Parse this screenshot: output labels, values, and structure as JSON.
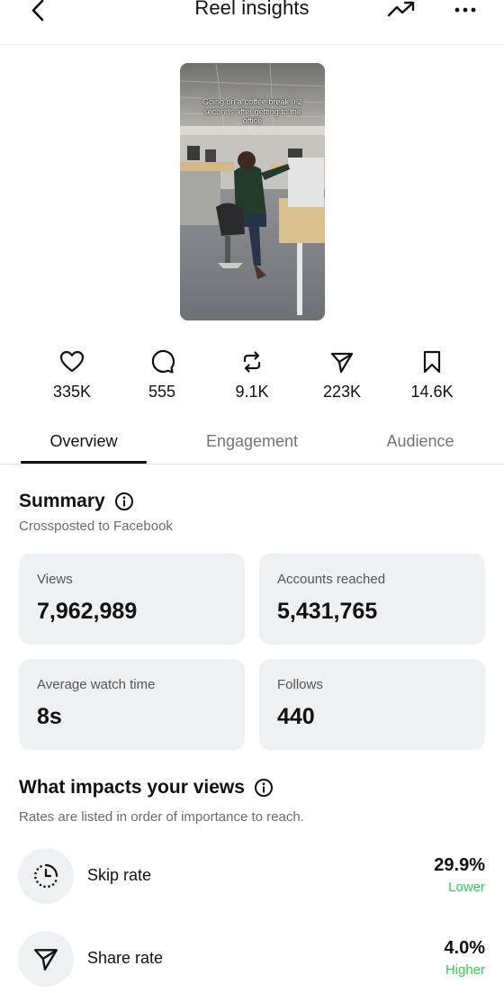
{
  "header": {
    "title": "Reel insights",
    "back_icon": "chevron-left-icon",
    "trend_icon": "trending-up-icon",
    "more_icon": "more-horizontal-icon"
  },
  "thumbnail": {
    "caption": "Going on a coffee break 0.2 seconds after getting to the office"
  },
  "stats": [
    {
      "icon": "heart-icon",
      "value": "335K"
    },
    {
      "icon": "comment-icon",
      "value": "555"
    },
    {
      "icon": "repost-icon",
      "value": "9.1K"
    },
    {
      "icon": "share-icon",
      "value": "223K"
    },
    {
      "icon": "bookmark-icon",
      "value": "14.6K"
    }
  ],
  "tabs": {
    "overview": "Overview",
    "engagement": "Engagement",
    "audience": "Audience",
    "active": "Overview"
  },
  "summary": {
    "title": "Summary",
    "subtitle": "Crossposted to Facebook",
    "cards": {
      "views": {
        "label": "Views",
        "value": "7,962,989"
      },
      "accounts_reached": {
        "label": "Accounts reached",
        "value": "5,431,765"
      },
      "avg_watch_time": {
        "label": "Average watch time",
        "value": "8s"
      },
      "follows": {
        "label": "Follows",
        "value": "440"
      }
    }
  },
  "impacts": {
    "title": "What impacts your views",
    "subtitle": "Rates are listed in order of importance to reach.",
    "metrics": {
      "skip": {
        "icon": "clock-dotted-icon",
        "name": "Skip rate",
        "value": "29.9%",
        "comparison": "Lower"
      },
      "share": {
        "icon": "share-icon",
        "name": "Share rate",
        "value": "4.0%",
        "comparison": "Higher"
      }
    }
  },
  "colors": {
    "positive": "#2ecc52",
    "card_bg": "#eff0f2",
    "muted_text": "#737373"
  }
}
